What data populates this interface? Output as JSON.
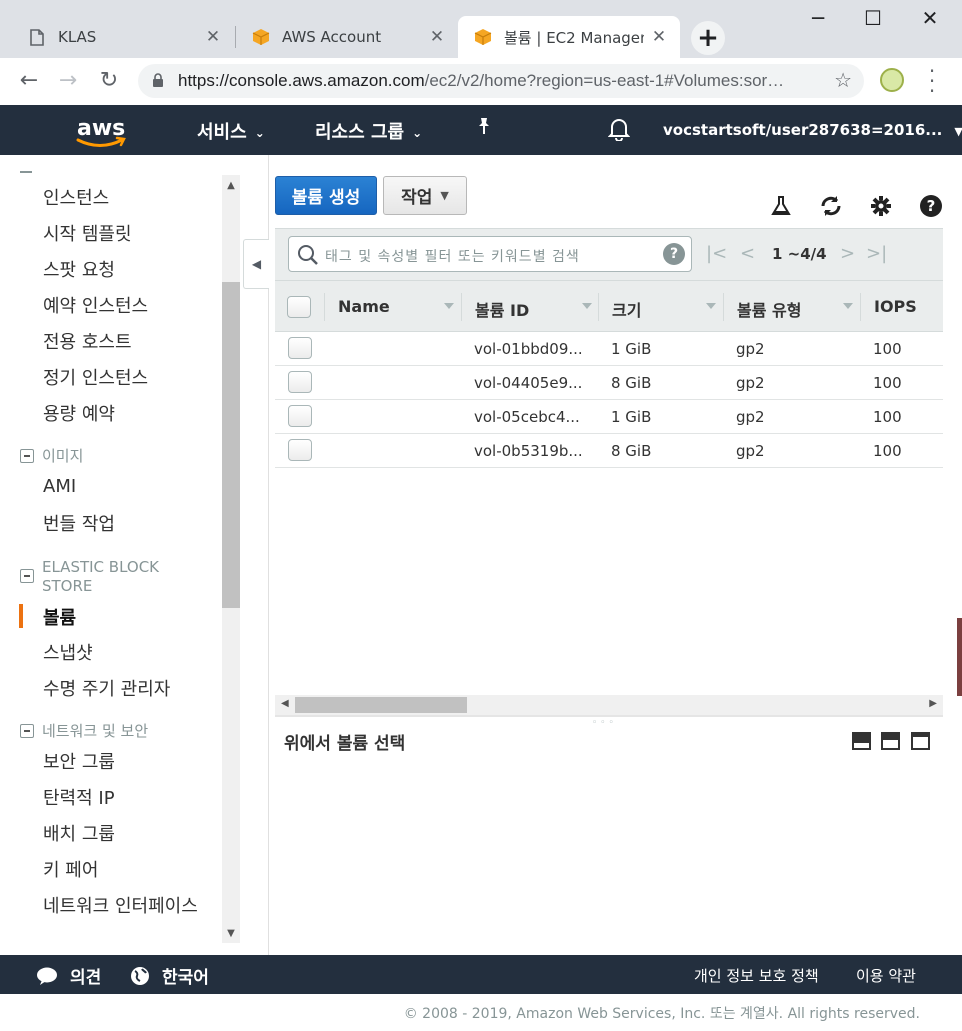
{
  "browser": {
    "tabs": [
      {
        "title": "KLAS",
        "icon": "document-icon",
        "active": false
      },
      {
        "title": "AWS Account",
        "icon": "aws-box-icon",
        "active": false
      },
      {
        "title": "볼륨 | EC2 Managem",
        "icon": "aws-box-icon",
        "active": true
      }
    ],
    "url_host": "https://console.aws.amazon.com",
    "url_path": "/ec2/v2/home?region=us-east-1#Volumes:sor…"
  },
  "header": {
    "services": "서비스",
    "resource_groups": "리소스 그룹",
    "account": "vocstartsoft/user287638=2016..."
  },
  "sidebar": {
    "instance_items": [
      "인스턴스",
      "시작 템플릿",
      "스팟 요청",
      "예약 인스턴스",
      "전용 호스트",
      "정기 인스턴스",
      "용량 예약"
    ],
    "sections": {
      "images": {
        "title": "이미지",
        "items": [
          "AMI",
          "번들 작업"
        ]
      },
      "ebs": {
        "title_line1": "ELASTIC BLOCK",
        "title_line2": "STORE",
        "items": [
          "볼륨",
          "스냅샷",
          "수명 주기 관리자"
        ],
        "active": "볼륨"
      },
      "network": {
        "title": "네트워크 및 보안",
        "items": [
          "보안 그룹",
          "탄력적 IP",
          "배치 그룹",
          "키 페어",
          "네트워크 인터페이스"
        ]
      }
    }
  },
  "toolbar": {
    "create_volume": "볼륨 생성",
    "actions": "작업"
  },
  "filter": {
    "placeholder": "태그 및 속성별 필터 또는 키워드별 검색",
    "pagination": "1 ~4/4"
  },
  "table": {
    "columns": [
      "Name",
      "볼륨 ID",
      "크기",
      "볼륨 유형",
      "IOPS"
    ],
    "rows": [
      {
        "name": "",
        "volume_id": "vol-01bbd09...",
        "size": "1 GiB",
        "type": "gp2",
        "iops": "100"
      },
      {
        "name": "",
        "volume_id": "vol-04405e9...",
        "size": "8 GiB",
        "type": "gp2",
        "iops": "100"
      },
      {
        "name": "",
        "volume_id": "vol-05cebc4...",
        "size": "1 GiB",
        "type": "gp2",
        "iops": "100"
      },
      {
        "name": "",
        "volume_id": "vol-0b5319b...",
        "size": "8 GiB",
        "type": "gp2",
        "iops": "100"
      }
    ]
  },
  "detail": {
    "title": "위에서 볼륨 선택"
  },
  "footer": {
    "feedback": "의견",
    "language": "한국어",
    "privacy": "개인 정보 보호 정책",
    "terms": "이용 약관",
    "copyright": "© 2008 - 2019, Amazon Web Services, Inc. 또는 계열사. All rights reserved."
  },
  "colors": {
    "aws_navy": "#232f3e",
    "primary_blue": "#1666c0",
    "active_orange": "#ec7211"
  }
}
